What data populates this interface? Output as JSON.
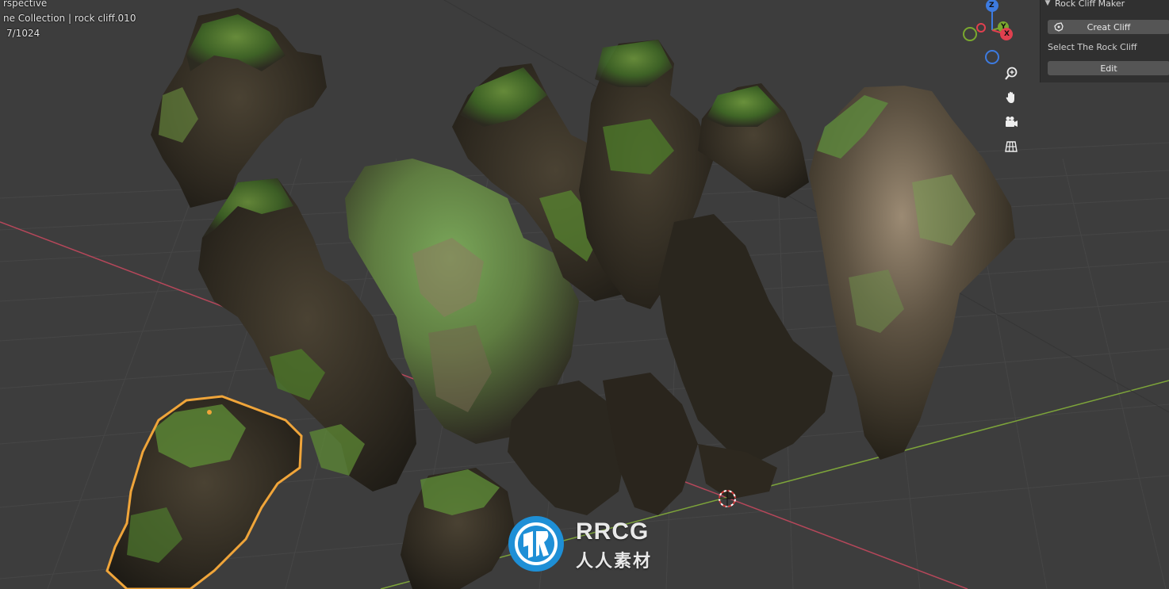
{
  "viewport": {
    "view_label": "rspective",
    "object_label": "ne Collection | rock cliff.010",
    "frame_label": "7/1024"
  },
  "gizmo": {
    "axes": [
      {
        "label": "Z",
        "color": "#3d7be0"
      },
      {
        "label": "Y",
        "color": "#7aa82f"
      },
      {
        "label": "X",
        "color": "#e0404f"
      }
    ]
  },
  "nav_tools": [
    {
      "icon": "zoom-icon"
    },
    {
      "icon": "hand-pan-icon"
    },
    {
      "icon": "camera-icon"
    },
    {
      "icon": "grid-ortho-icon"
    }
  ],
  "panel": {
    "title": "Rock Cliff Maker",
    "create_button": "Creat Cliff",
    "select_label": "Select The Rock Cliff",
    "edit_button": "Edit"
  },
  "watermark": {
    "brand": "RRCG",
    "subtitle": "人人素材"
  },
  "colors": {
    "viewport_bg": "#3d3d3d",
    "selection_outline": "#f0a53a",
    "x_axis_line": "#b5475a",
    "y_axis_line": "#7da43a",
    "rock": "#2c2820",
    "moss": "#4d7f2c"
  }
}
